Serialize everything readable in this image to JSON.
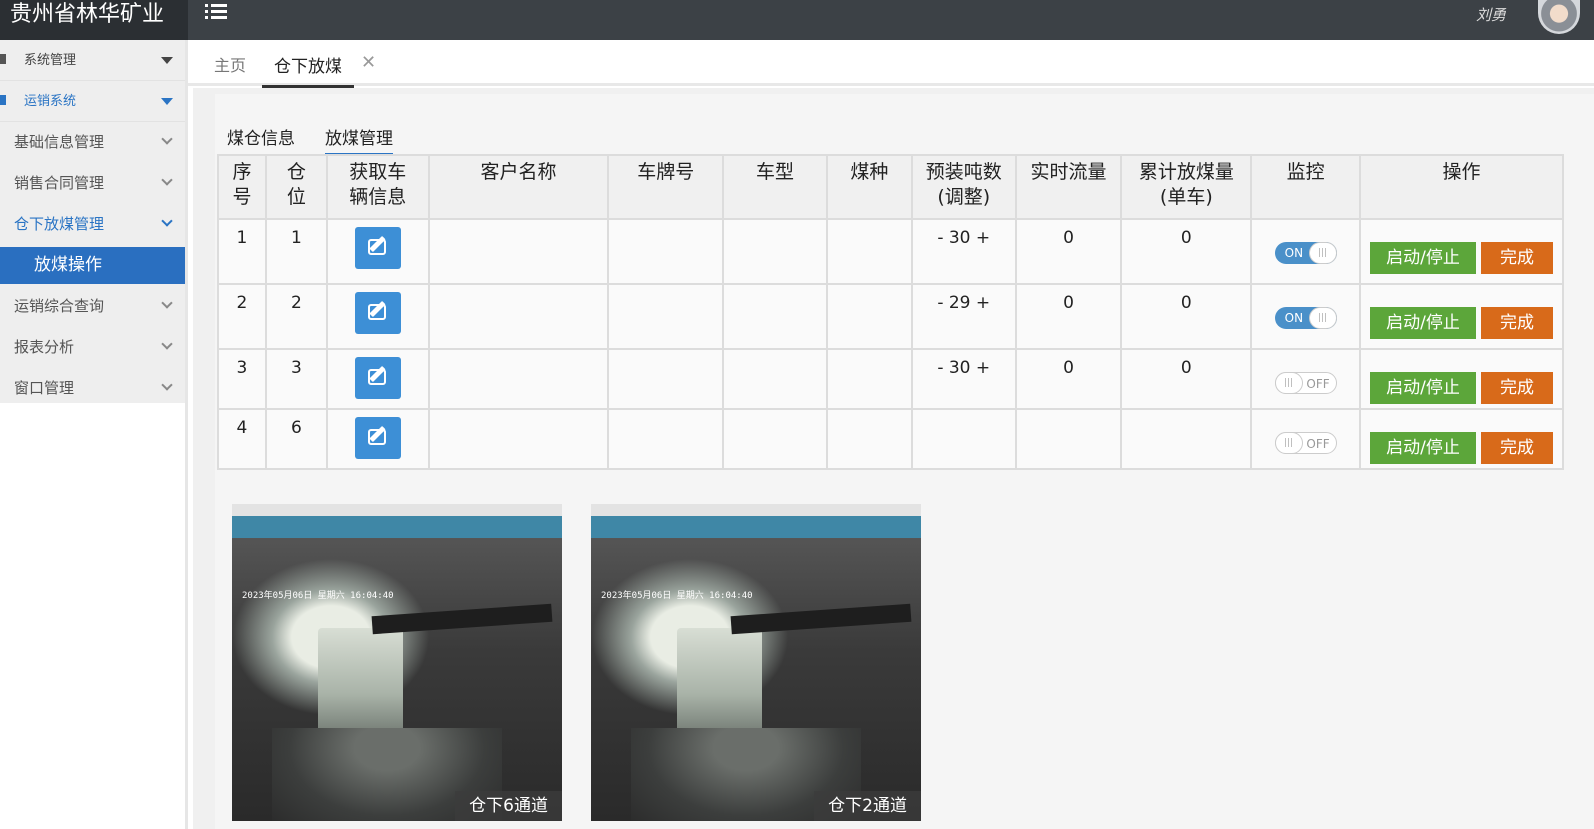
{
  "app": {
    "brand": "贵州省林华矿业",
    "username": "刘勇"
  },
  "sidebar": {
    "items": [
      {
        "label": "系统管理"
      },
      {
        "label": "运销系统"
      },
      {
        "label": "基础信息管理"
      },
      {
        "label": "销售合同管理"
      },
      {
        "label": "仓下放煤管理"
      },
      {
        "label": "放煤操作"
      },
      {
        "label": "运销综合查询"
      },
      {
        "label": "报表分析"
      },
      {
        "label": "窗口管理"
      }
    ]
  },
  "tabs": {
    "home": "主页",
    "current": "仓下放煤",
    "close": "✕"
  },
  "subtabs": {
    "a": "煤仓信息",
    "b": "放煤管理"
  },
  "table": {
    "headers": {
      "seq": [
        "序",
        "号"
      ],
      "bin": [
        "仓",
        "位"
      ],
      "fetch": [
        "获取车",
        "辆信息"
      ],
      "customer": "客户名称",
      "plate": "车牌号",
      "model": "车型",
      "coal": "煤种",
      "preset": [
        "预装吨数",
        "(调整)"
      ],
      "flow": "实时流量",
      "total": [
        "累计放煤量",
        "(单车)"
      ],
      "monitor": "监控",
      "ops": "操作"
    },
    "rows": [
      {
        "seq": "1",
        "bin": "1",
        "preset": "- 30 +",
        "flow": "0",
        "total": "0",
        "monitor": "ON"
      },
      {
        "seq": "2",
        "bin": "2",
        "preset": "- 29 +",
        "flow": "0",
        "total": "0",
        "monitor": "ON"
      },
      {
        "seq": "3",
        "bin": "3",
        "preset": "- 30 +",
        "flow": "0",
        "total": "0",
        "monitor": "OFF"
      },
      {
        "seq": "4",
        "bin": "6",
        "preset": "",
        "flow": "",
        "total": "",
        "monitor": "OFF"
      }
    ],
    "knob_glyph": "|||",
    "start_label": "启动/停止",
    "done_label": "完成"
  },
  "cameras": [
    {
      "label": "仓下6通道",
      "timestamp": "2023年05月06日 星期六 16:04:40"
    },
    {
      "label": "仓下2通道",
      "timestamp": "2023年05月06日 星期六 16:04:40"
    }
  ]
}
